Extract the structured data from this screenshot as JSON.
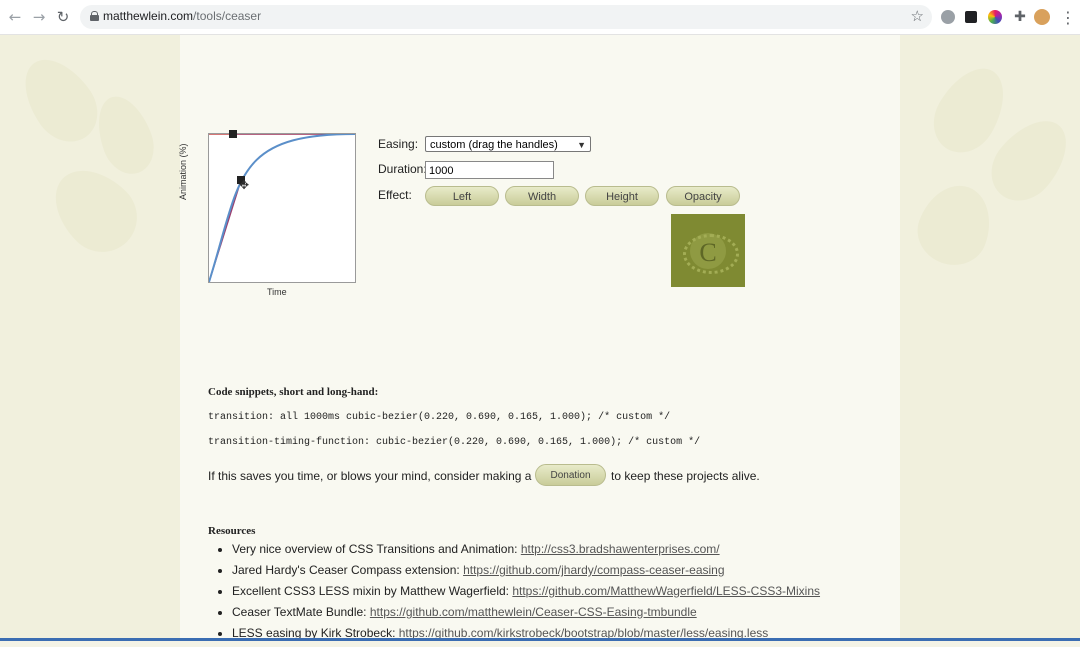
{
  "browser": {
    "url_domain": "matthewlein.com",
    "url_path": "/tools/ceaser",
    "back_icon": "arrow-left-icon",
    "forward_icon": "arrow-right-icon",
    "reload_icon": "reload-icon"
  },
  "graph": {
    "ylabel": "Animation (%)",
    "xlabel": "Time"
  },
  "form": {
    "easing_label": "Easing:",
    "easing_value": "custom (drag the handles)",
    "duration_label": "Duration:",
    "duration_value": "1000",
    "effect_label": "Effect:",
    "effects": [
      "Left",
      "Width",
      "Height",
      "Opacity"
    ]
  },
  "demo": {
    "letter": "C",
    "colors": {
      "box": "#7f8a32",
      "accent": "#5e6726"
    }
  },
  "code": {
    "heading": "Code snippets, short and long-hand:",
    "line1": "transition: all 1000ms cubic-bezier(0.220, 0.690, 0.165, 1.000); /* custom */",
    "line2": "transition-timing-function: cubic-bezier(0.220, 0.690, 0.165, 1.000); /* custom */"
  },
  "donation": {
    "before": "If this saves you time, or blows your mind, consider making a",
    "button": "Donation",
    "after": "to keep these projects alive."
  },
  "resources": {
    "heading": "Resources",
    "items": [
      {
        "text": "Very nice overview of CSS Transitions and Animation: ",
        "link": "http://css3.bradshawenterprises.com/"
      },
      {
        "text": "Jared Hardy's Ceaser Compass extension: ",
        "link": "https://github.com/jhardy/compass-ceaser-easing"
      },
      {
        "text": "Excellent CSS3 LESS mixin by Matthew Wagerfield: ",
        "link": "https://github.com/MatthewWagerfield/LESS-CSS3-Mixins"
      },
      {
        "text": "Ceaser TextMate Bundle: ",
        "link": "https://github.com/matthewlein/Ceaser-CSS-Easing-tmbundle"
      },
      {
        "text": "LESS easing by Kirk Strobeck: ",
        "link": "https://github.com/kirkstrobeck/bootstrap/blob/master/less/easing.less"
      }
    ]
  }
}
